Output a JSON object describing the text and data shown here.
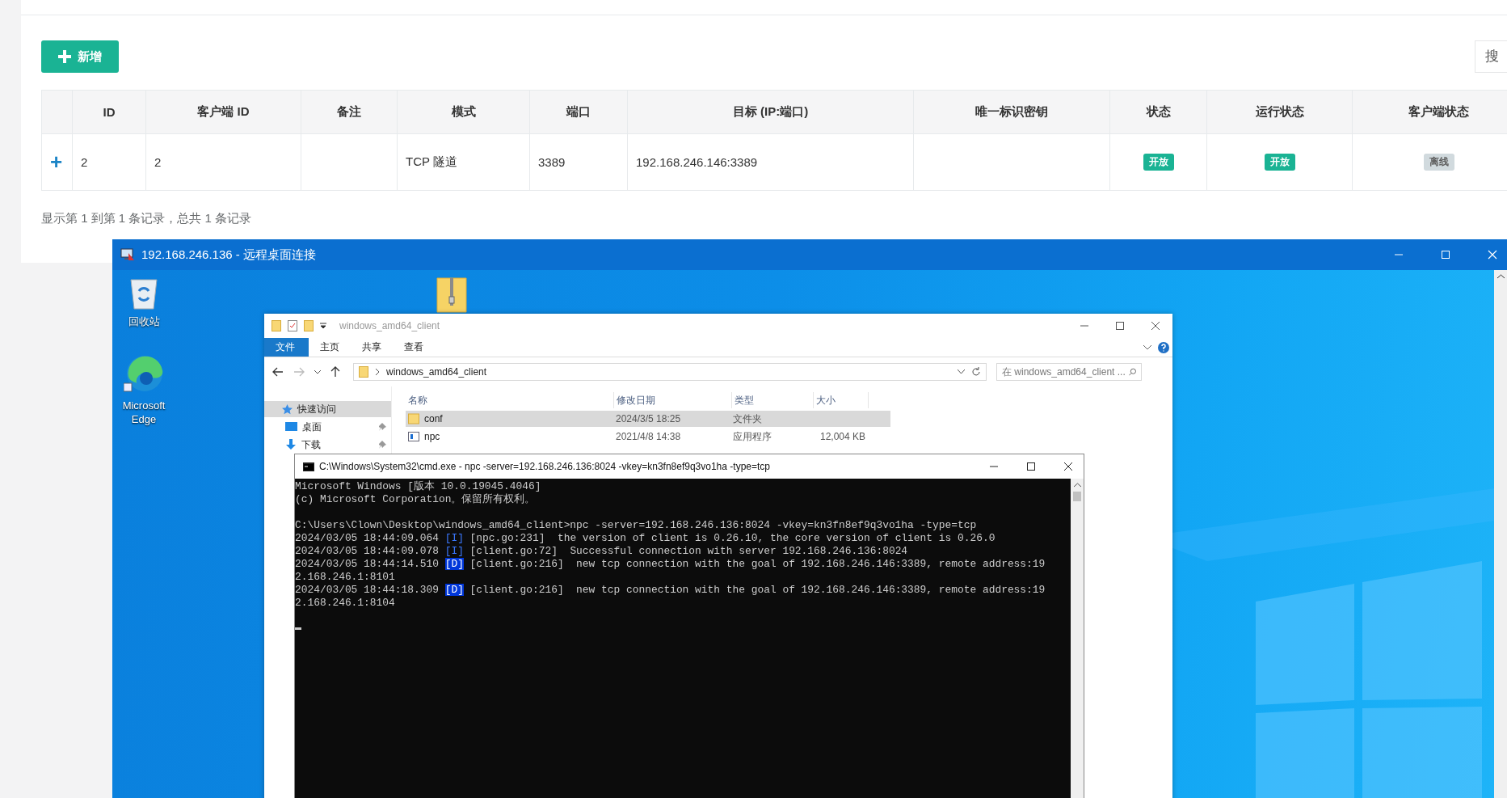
{
  "web": {
    "add_button": "新增",
    "search_placeholder": "搜",
    "columns": [
      "",
      "ID",
      "客户端 ID",
      "备注",
      "模式",
      "端口",
      "目标 (IP:端口)",
      "唯一标识密钥",
      "状态",
      "运行状态",
      "客户端状态"
    ],
    "rows": [
      {
        "cells": [
          {
            "kind": "expand",
            "text": "+"
          },
          {
            "kind": "text",
            "text": "2"
          },
          {
            "kind": "text",
            "text": "2"
          },
          {
            "kind": "empty"
          },
          {
            "kind": "text",
            "text": "TCP 隧道"
          },
          {
            "kind": "text",
            "text": "3389"
          },
          {
            "kind": "text",
            "text": "192.168.246.146:3389"
          },
          {
            "kind": "empty"
          },
          {
            "kind": "badge",
            "text": "开放",
            "color": "#1ab394"
          },
          {
            "kind": "badge",
            "text": "开放",
            "color": "#1ab394"
          },
          {
            "kind": "badge",
            "text": "离线",
            "color": "#d1dade"
          }
        ]
      }
    ],
    "footer": "显示第 1 到第 1 条记录，总共 1 条记录"
  },
  "rdp": {
    "title": "192.168.246.136 - 远程桌面连接",
    "desktop_icons": [
      {
        "kind": "recycle",
        "label": "回收站"
      },
      {
        "kind": "edge",
        "label": "Microsoft Edge"
      },
      {
        "kind": "zip"
      }
    ],
    "explorer": {
      "title": "windows_amd64_client",
      "tabs": [
        {
          "label": "文件",
          "selected": true
        },
        {
          "label": "主页",
          "selected": false
        },
        {
          "label": "共享",
          "selected": false
        },
        {
          "label": "查看",
          "selected": false
        }
      ],
      "address": "windows_amd64_client",
      "search_placeholder": "在 windows_amd64_client ...",
      "nav": [
        {
          "kind": "star",
          "label": "快速访问",
          "selected": true,
          "pinned": false
        },
        {
          "kind": "desktop",
          "label": "桌面",
          "selected": false,
          "pinned": true
        },
        {
          "kind": "download",
          "label": "下载",
          "selected": false,
          "pinned": true
        }
      ],
      "columns": [
        "名称",
        "修改日期",
        "类型",
        "大小"
      ],
      "files": [
        {
          "kind": "folder",
          "name": "conf",
          "date": "2024/3/5 18:25",
          "type": "文件夹",
          "selected": true
        },
        {
          "kind": "app",
          "name": "npc",
          "date": "2021/4/8 14:38",
          "type": "应用程序",
          "size": "12,004 KB",
          "selected": false
        }
      ]
    },
    "cmd": {
      "title": "C:\\Windows\\System32\\cmd.exe - npc  -server=192.168.246.136:8024 -vkey=kn3fn8ef9q3vo1ha -type=tcp",
      "lines": [
        {
          "kind": "plain",
          "text": "Microsoft Windows [版本 10.0.19045.4046]"
        },
        {
          "kind": "plain",
          "text": "(c) Microsoft Corporation。保留所有权利。"
        },
        {
          "kind": "blank"
        },
        {
          "kind": "plain",
          "text": "C:\\Users\\Clown\\Desktop\\windows_amd64_client>npc -server=192.168.246.136:8024 -vkey=kn3fn8ef9q3vo1ha -type=tcp"
        },
        {
          "kind": "log",
          "time": "2024/03/05 18:44:09.064",
          "tag": "[I]",
          "highlighted": false,
          "text": "[npc.go:231]  the version of client is 0.26.10, the core version of client is 0.26.0"
        },
        {
          "kind": "log",
          "time": "2024/03/05 18:44:09.078",
          "tag": "[I]",
          "highlighted": false,
          "text": "[client.go:72]  Successful connection with server 192.168.246.136:8024"
        },
        {
          "kind": "log",
          "time": "2024/03/05 18:44:14.510",
          "tag": "[D]",
          "highlighted": true,
          "text": "[client.go:216]  new tcp connection with the goal of 192.168.246.146:3389, remote address:19"
        },
        {
          "kind": "plain",
          "text": "2.168.246.1:8101"
        },
        {
          "kind": "log",
          "time": "2024/03/05 18:44:18.309",
          "tag": "[D]",
          "highlighted": true,
          "text": "[client.go:216]  new tcp connection with the goal of 192.168.246.146:3389, remote address:19"
        },
        {
          "kind": "plain",
          "text": "2.168.246.1:8104"
        },
        {
          "kind": "blank"
        },
        {
          "kind": "cursor"
        }
      ]
    }
  }
}
